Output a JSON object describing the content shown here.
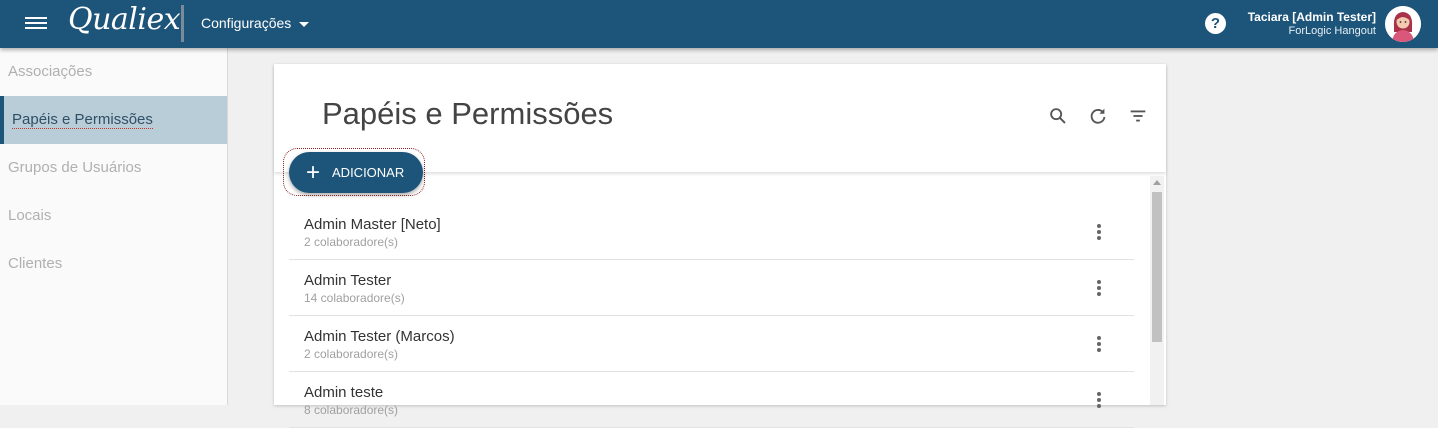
{
  "app": {
    "logo": "Qualiex",
    "section_menu": "Configurações"
  },
  "user": {
    "name": "Taciara [Admin Tester]",
    "company": "ForLogic Hangout"
  },
  "sidebar": {
    "items": [
      {
        "label": "Associações"
      },
      {
        "label": "Papéis e Permissões"
      },
      {
        "label": "Grupos de Usuários"
      },
      {
        "label": "Locais"
      },
      {
        "label": "Clientes"
      }
    ],
    "active_index": 1
  },
  "page": {
    "title": "Papéis e Permissões",
    "add_label": "ADICIONAR"
  },
  "roles": [
    {
      "name": "Admin Master [Neto]",
      "members": "2 colaboradore(s)"
    },
    {
      "name": "Admin Tester",
      "members": "14 colaboradore(s)"
    },
    {
      "name": "Admin Tester (Marcos)",
      "members": "2 colaboradore(s)"
    },
    {
      "name": "Admin teste",
      "members": "8 colaboradore(s)"
    }
  ],
  "colors": {
    "brand": "#1d5479",
    "active_bg": "#b9cdd9"
  },
  "icons": [
    "menu-icon",
    "chevron-down-icon",
    "help-icon",
    "search-icon",
    "refresh-icon",
    "filter-icon",
    "plus-icon",
    "more-vert-icon"
  ]
}
